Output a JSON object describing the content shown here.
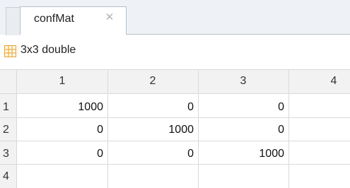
{
  "tab": {
    "title": "confMat",
    "close_icon": "close-icon"
  },
  "variable": {
    "icon": "grid-table-icon",
    "size_label": "3x3 double"
  },
  "table": {
    "columns": [
      "1",
      "2",
      "3",
      "4"
    ],
    "rows": [
      "1",
      "2",
      "3",
      "4"
    ],
    "cells": [
      [
        "1000",
        "0",
        "0",
        ""
      ],
      [
        "0",
        "1000",
        "0",
        ""
      ],
      [
        "0",
        "0",
        "1000",
        ""
      ],
      [
        "",
        "",
        "",
        ""
      ]
    ]
  },
  "colors": {
    "tab_strip": "#eef2f7",
    "header_bg": "#f2f2f2",
    "grid_line": "#dadada",
    "icon_accent": "#f2b233"
  }
}
